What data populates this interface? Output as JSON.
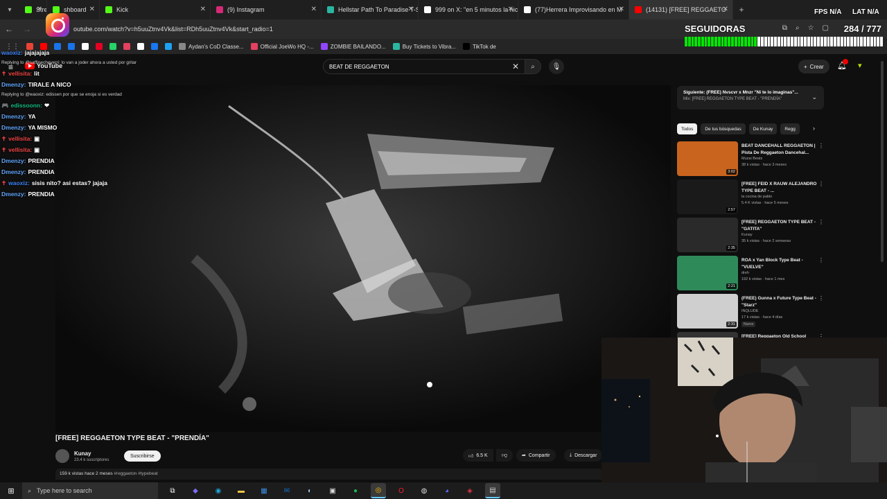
{
  "browser": {
    "tabs": [
      {
        "label": "Stre",
        "color": "#53fc18",
        "active": false
      },
      {
        "label": "shboard",
        "color": "#53fc18",
        "active": false
      },
      {
        "label": "Kick",
        "color": "#53fc18",
        "active": false
      },
      {
        "label": "(9) Instagram",
        "color": "#d62976",
        "active": false
      },
      {
        "label": "Hellstar Path To Paradise T-Shi",
        "color": "#2bb5a0",
        "active": false
      },
      {
        "label": "999 on X: \"en 5 minutos la hice",
        "color": "#ffffff",
        "active": false
      },
      {
        "label": "(77)Herrera Improvisando en M",
        "color": "#ffffff",
        "active": false
      },
      {
        "label": "(14131) [FREE] REGGAETO",
        "color": "#ff0000",
        "active": true
      }
    ],
    "url": "outube.com/watch?v=h5uuZtnv4Vk&list=RDh5uuZtnv4Vk&start_radio=1",
    "bookmarks": [
      {
        "label": "",
        "color": "#ea4335"
      },
      {
        "label": "",
        "color": "#ff0000"
      },
      {
        "label": "",
        "color": "#1a73e8"
      },
      {
        "label": "",
        "color": "#1a73e8"
      },
      {
        "label": "",
        "color": "#ffffff"
      },
      {
        "label": "",
        "color": "#e60023"
      },
      {
        "label": "",
        "color": "#25d366"
      },
      {
        "label": "",
        "color": "#e4405f"
      },
      {
        "label": "",
        "color": "#ffffff"
      },
      {
        "label": "",
        "color": "#1877f2"
      },
      {
        "label": "",
        "color": "#1da1f2"
      },
      {
        "label": "Aydan's CoD Classe...",
        "color": "#888888"
      },
      {
        "label": "Official JoeWo HQ -...",
        "color": "#e4405f"
      },
      {
        "label": "ZOMBIE BAILANDO...",
        "color": "#9146ff"
      },
      {
        "label": "Buy Tickets to Vibra...",
        "color": "#2bb5a0"
      },
      {
        "label": "TikTok de",
        "color": "#000000"
      }
    ]
  },
  "youtube": {
    "logo": "YouTube",
    "search_value": "BEAT DE REGGAETON",
    "create_label": "Crear",
    "video_title": "[FREE] REGGAETON TYPE BEAT - \"PRENDÍA\"",
    "channel_name": "Kunay",
    "channel_subs": "23.4 k suscriptores",
    "subscribe_label": "Suscribirse",
    "likes": "6.5 K",
    "share_label": "Compartir",
    "download_label": "Descargar",
    "desc_stats": "159 k vistas  hace 2 meses",
    "desc_tags": "#reggaeton #typebeat",
    "up_next_line1": "Siguiente: (FREE) Nvscvr x Mnzr \"Ni te lo imaginas\"...",
    "up_next_line2": "Mix: [FREE] REGGAETON TYPE BEAT - \"PRENDÍA\"",
    "chips": [
      "Todos",
      "De tus búsquedas",
      "De Kunay",
      "Regg"
    ],
    "recommendations": [
      {
        "title": "BEAT DANCEHALL REGGAETON | Pista De Reggaeton Dancehal...",
        "channel": "Muzai Beats",
        "meta": "38 k vistas · hace 3 meses",
        "duration": "3:02",
        "badge": ""
      },
      {
        "title": "[FREE] FEID X RAUW ALEJANDRO TYPE BEAT - ...",
        "channel": "la cocina de pablo",
        "meta": "5.4 K vistas · hace 5 meses",
        "duration": "2:57",
        "badge": ""
      },
      {
        "title": "[FREE] REGGAETON TYPE BEAT - \"GATITA\"",
        "channel": "Kunay",
        "meta": "35 k vistas · hace 2 semanas",
        "duration": "2:35",
        "badge": ""
      },
      {
        "title": "ROA x Yan Block Type Beat - \"VUELVE\"",
        "channel": "dreh",
        "meta": "192 k vistas · hace 1 mes",
        "duration": "2:21",
        "badge": ""
      },
      {
        "title": "(FREE) Gunna x Future Type Beat - \"Starz\"",
        "channel": "INQLUDE",
        "meta": "17 k vistas · hace 4 días",
        "duration": "2:31",
        "badge": "Nuevo"
      },
      {
        "title": "[FREE] Reggaeton Old School",
        "channel": "",
        "meta": "",
        "duration": "",
        "badge": ""
      }
    ]
  },
  "overlay": {
    "chat": [
      {
        "type": "msg",
        "user": "waoxiz:",
        "color": "#3b82f6",
        "msg": "jajajajaja",
        "badge": ""
      },
      {
        "type": "reply",
        "text": "Replying to @saffinecheverri: lo van a joder ahora a usted por gritar"
      },
      {
        "type": "msg",
        "user": "vellisita:",
        "color": "#ef4444",
        "msg": "lit",
        "badge": "✝"
      },
      {
        "type": "msg",
        "user": "Dmenzy:",
        "color": "#60a5fa",
        "msg": "TIRALE A NICO",
        "badge": ""
      },
      {
        "type": "reply",
        "text": "Replying to @waoxiz: edissen por que se enoja si es verdad"
      },
      {
        "type": "msg",
        "user": "edissoonn:",
        "color": "#10b981",
        "msg": "❤",
        "badge": "🎮"
      },
      {
        "type": "msg",
        "user": "Dmenzy:",
        "color": "#60a5fa",
        "msg": "YA",
        "badge": ""
      },
      {
        "type": "msg",
        "user": "Dmenzy:",
        "color": "#60a5fa",
        "msg": "YA MISMO",
        "badge": ""
      },
      {
        "type": "msg",
        "user": "vellisita:",
        "color": "#ef4444",
        "msg": "▣",
        "badge": "✝"
      },
      {
        "type": "msg",
        "user": "vellisita:",
        "color": "#ef4444",
        "msg": "▣",
        "badge": "✝"
      },
      {
        "type": "msg",
        "user": "Dmenzy:",
        "color": "#60a5fa",
        "msg": "PRENDIA",
        "badge": ""
      },
      {
        "type": "msg",
        "user": "Dmenzy:",
        "color": "#60a5fa",
        "msg": "PRENDIA",
        "badge": ""
      },
      {
        "type": "msg",
        "user": "waoxiz:",
        "color": "#3b82f6",
        "msg": "sisis nito? asi estas? jajaja",
        "badge": "✝"
      },
      {
        "type": "msg",
        "user": "Dmenzy:",
        "color": "#60a5fa",
        "msg": "PRENDIA",
        "badge": ""
      }
    ],
    "followers_title": "SEGUIDORAS",
    "followers_count": "284 / 777",
    "followers_progress": 0.365,
    "fps": "FPS  N/A",
    "lat": "LAT  N/A"
  },
  "taskbar": {
    "search_placeholder": "Type here to search",
    "apps": [
      {
        "icon": "task-view-icon",
        "glyph": "⧉",
        "color": "#ffffff",
        "active": false
      },
      {
        "icon": "copilot-icon",
        "glyph": "◆",
        "color": "#7c6cf0",
        "active": false
      },
      {
        "icon": "edge-icon",
        "glyph": "◉",
        "color": "#1fa6e0",
        "active": false
      },
      {
        "icon": "file-explorer-icon",
        "glyph": "▬",
        "color": "#f5c542",
        "active": false
      },
      {
        "icon": "store-icon",
        "glyph": "▦",
        "color": "#3a8ee6",
        "active": false
      },
      {
        "icon": "outlook-icon",
        "glyph": "✉",
        "color": "#1173d1",
        "active": false
      },
      {
        "icon": "steam-icon",
        "glyph": "◐",
        "color": "#a0c4e8",
        "active": false
      },
      {
        "icon": "epic-icon",
        "glyph": "▣",
        "color": "#dddddd",
        "active": false
      },
      {
        "icon": "spotify-icon",
        "glyph": "●",
        "color": "#1db954",
        "active": false
      },
      {
        "icon": "chrome-icon",
        "glyph": "◎",
        "color": "#fbbc05",
        "active": true
      },
      {
        "icon": "opera-icon",
        "glyph": "O",
        "color": "#ff1b2d",
        "active": false
      },
      {
        "icon": "obs-icon",
        "glyph": "◍",
        "color": "#dddddd",
        "active": false
      },
      {
        "icon": "discord-icon",
        "glyph": "◕",
        "color": "#5865f2",
        "active": false
      },
      {
        "icon": "app-red-icon",
        "glyph": "◈",
        "color": "#e0334a",
        "active": false
      },
      {
        "icon": "app-green-icon",
        "glyph": "▤",
        "color": "#cccccc",
        "active": true
      }
    ]
  }
}
